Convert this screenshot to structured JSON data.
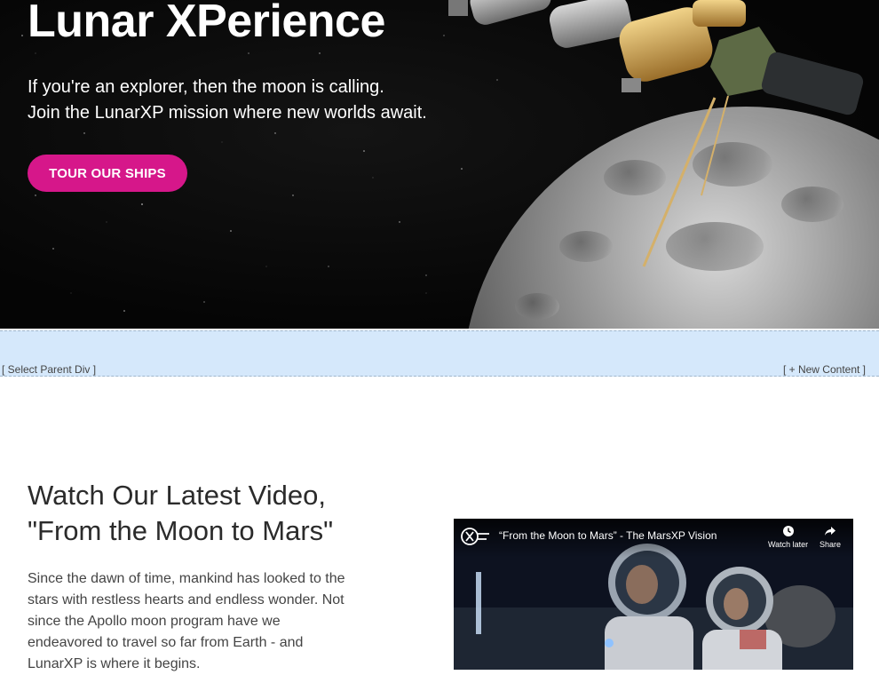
{
  "hero": {
    "title": "Lunar XPerience",
    "line1": "If you're an explorer, then the moon is calling.",
    "line2": "Join the LunarXP mission where new worlds await.",
    "cta_label": "TOUR OUR SHIPS"
  },
  "editor": {
    "select_parent": "[ Select Parent Div ]",
    "new_content": "[ + New Content ]"
  },
  "video_section": {
    "title_line1": "Watch Our Latest Video,",
    "title_line2": "\"From the Moon to Mars\"",
    "body_lines": [
      "Since the dawn of time, mankind has looked to the",
      "stars with restless hearts and endless wonder. Not",
      "since the Apollo moon program have we",
      "endeavored to travel so far from Earth - and",
      "LunarXP is where it begins."
    ]
  },
  "video": {
    "title": "“From the Moon to Mars” - The MarsXP Vision",
    "watch_later": "Watch later",
    "share": "Share",
    "logo_text": "XP"
  },
  "colors": {
    "accent": "#d6178a",
    "editor_bar": "#d5e8fb",
    "heading": "#2b2b2b"
  }
}
